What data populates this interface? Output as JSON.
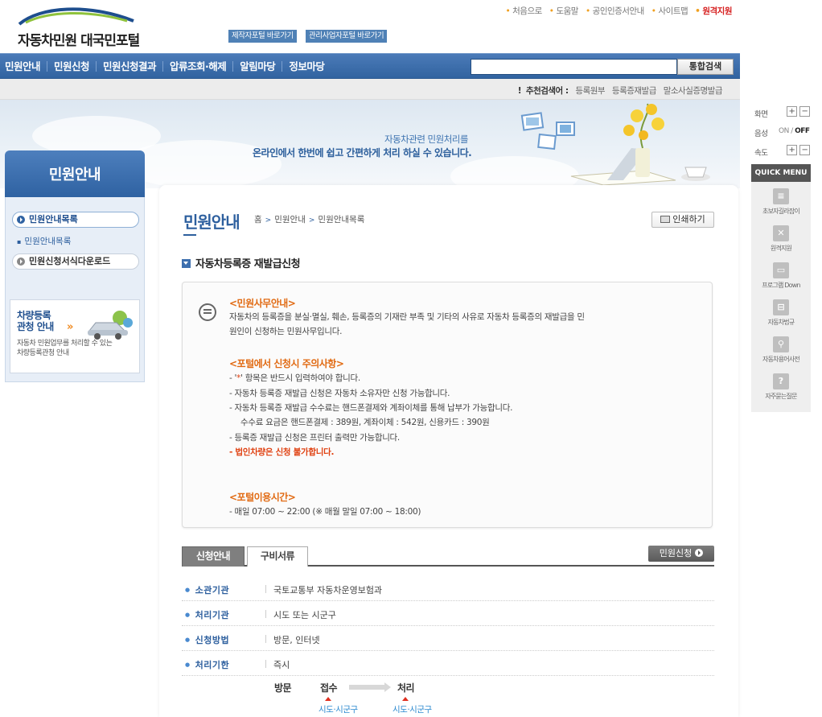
{
  "header": {
    "logo_text": "자동차민원 대국민포털",
    "portal_links": [
      "제작자포털 바로가기",
      "관리사업자포털 바로가기"
    ],
    "util_links": [
      "처음으로",
      "도움말",
      "공인인증서안내",
      "사이트맵"
    ],
    "util_highlight": "원격지원"
  },
  "gnb": {
    "items": [
      "민원안내",
      "민원신청",
      "민원신청결과",
      "압류조회·해제",
      "알림마당",
      "정보마당"
    ],
    "search_placeholder": "",
    "search_button": "통합검색"
  },
  "keywords": {
    "label": "추천검색어 :",
    "words": [
      "등록원부",
      "등록증재발급",
      "말소사실증명발급"
    ]
  },
  "banner": {
    "line1": "자동차관련 민원처리를",
    "line2": "온라인에서 한번에 쉽고 간편하게 처리 하실 수 있습니다."
  },
  "sidebar": {
    "title": "민원안내",
    "items": [
      {
        "label": "민원안내목록",
        "active": true
      },
      {
        "label": "민원신청서식다운로드",
        "active": false
      }
    ],
    "sub_item": "민원안내목록",
    "promo": {
      "title_line1": "차량등록",
      "title_line2": "관청 안내",
      "arrow": "»",
      "desc_line1": "자동차 민원업무를 처리할 수 있는",
      "desc_line2": "차량등록관청 안내"
    }
  },
  "main": {
    "page_title": "민원안내",
    "breadcrumb": [
      "홈",
      "민원안내",
      "민원안내목록"
    ],
    "print_button": "인쇄하기",
    "section_title": "자동차등록증 재발급신청",
    "info": {
      "head1": "<민원사무안내>",
      "text1_line1": "자동차의 등록증을 분실·멸실, 훼손, 등록증의 기재란 부족 및 기타의 사유로 자동차 등록증의 재발급을 민",
      "text1_line2": "원인이 신청하는 민원사무입니다.",
      "head2": "<포털에서 신청시 주의사항>",
      "notes": [
        {
          "prefix": "- '",
          "star": "*",
          "suffix": "' 항목은 반드시 입력하여야 합니다."
        },
        {
          "text": "- 자동차 등록증 재발급 신청은 자동차 소유자만 신청 가능합니다."
        },
        {
          "text": "- 자동차 등록증 재발급 수수료는 핸드폰결제와 계좌이체를 통해 납부가 가능합니다."
        },
        {
          "text": "수수료 요금은 핸드폰결제 : 389원, 계좌이체 : 542원, 신용카드 : 390원"
        },
        {
          "text": "- 등록증 재발급 신청은 프린터 출력만 가능합니다."
        },
        {
          "text": "- 법인차량은 신청 불가합니다."
        }
      ],
      "head3": "<포털이용시간>",
      "hours": "- 매일 07:00 ~ 22:00 (※ 매월 말일 07:00 ~ 18:00)"
    },
    "tabs": [
      "신청안내",
      "구비서류"
    ],
    "apply_button": "민원신청",
    "details": [
      {
        "key": "소관기관",
        "value": "국토교통부 자동차운영보험과"
      },
      {
        "key": "처리기관",
        "value": "시도 또는 시군구"
      },
      {
        "key": "신청방법",
        "value": "방문, 인터넷"
      },
      {
        "key": "처리기한",
        "value": "즉시"
      }
    ],
    "flow": {
      "label": "방문",
      "step1": "접수",
      "step2": "처리",
      "step1_sub": "시도·시군구",
      "step2_sub": "시도·시군구"
    }
  },
  "rail": {
    "screen_label": "화면",
    "sound_label": "음성",
    "sound_on": "ON",
    "sound_off": "OFF",
    "speed_label": "속도",
    "plus": "+",
    "minus": "−",
    "quick_menu": "QUICK MENU",
    "items": [
      "초보자길라잡이",
      "원격지원",
      "프로그램 Down",
      "자동차법규",
      "자동차용어사전",
      "자주묻는질문"
    ]
  }
}
